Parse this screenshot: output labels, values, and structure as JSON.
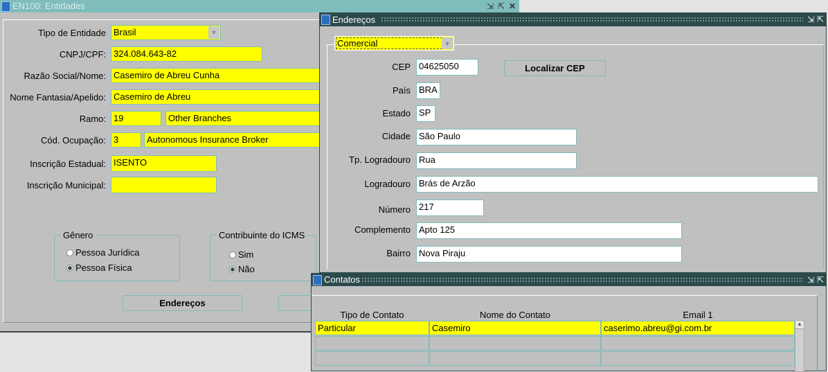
{
  "main": {
    "title": "EN100: Entidades",
    "fields": [
      {
        "label": "Tipo de Entidade",
        "value": "Brasil"
      },
      {
        "label": "CNPJ/CPF:",
        "value": "324.084.643-82"
      },
      {
        "label": "Razão Social/Nome:",
        "value": "Casemiro de Abreu Cunha"
      },
      {
        "label": "Nome Fantasia/Apelido:",
        "value": "Casemiro de Abreu"
      },
      {
        "label": "Ramo:",
        "code": "19",
        "value": "Other Branches"
      },
      {
        "label": "Cód. Ocupação:",
        "code": "3",
        "value": "Autonomous Insurance Broker"
      },
      {
        "label": "Inscrição Estadual:",
        "value": "ISENTO"
      },
      {
        "label": "Inscrição Municipal:",
        "value": ""
      }
    ],
    "genero": {
      "title": "Gênero",
      "options": [
        "Pessoa Jurídica",
        "Pessoa Física"
      ],
      "selected": "Pessoa Física"
    },
    "icms": {
      "title": "Contribuinte do ICMS",
      "options": [
        "Sim",
        "Não"
      ],
      "selected": "Não"
    },
    "enderecos_button": "Endereços"
  },
  "enderecos": {
    "title": "Endereços",
    "tipo": "Comercial",
    "localizar_button": "Localizar CEP",
    "fields": [
      {
        "label": "CEP",
        "value": "04625050"
      },
      {
        "label": "País",
        "value": "BRA"
      },
      {
        "label": "Estado",
        "value": "SP"
      },
      {
        "label": "Cidade",
        "value": "São Paulo"
      },
      {
        "label": "Tp. Logradouro",
        "value": "Rua"
      },
      {
        "label": "Logradouro",
        "value": "Brás de Arzão"
      },
      {
        "label": "Número",
        "value": "217"
      },
      {
        "label": "Complemento",
        "value": "Apto 125"
      },
      {
        "label": "Bairro",
        "value": "Nova Piraju"
      }
    ]
  },
  "contatos": {
    "title": "Contatos",
    "columns": [
      "Tipo de Contato",
      "Nome do Contato",
      "Email 1"
    ],
    "rows": [
      [
        "Particular",
        "Casemiro",
        "caserimo.abreu@gi.com.br"
      ],
      [
        "",
        "",
        ""
      ],
      [
        "",
        "",
        ""
      ]
    ]
  },
  "colors": {
    "field": "#ffff00",
    "title_main": "#7fbcbc",
    "title_dark": "#2c4a4a",
    "panel": "#c0c0c0"
  }
}
